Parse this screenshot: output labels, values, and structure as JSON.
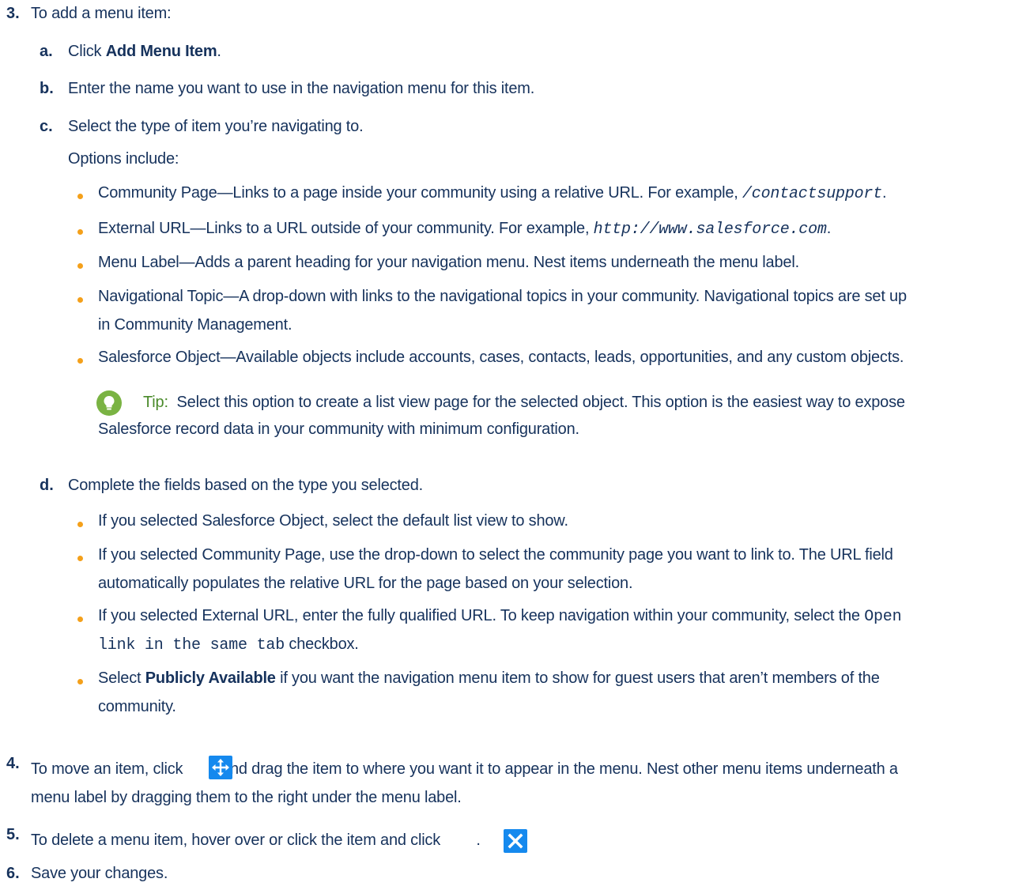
{
  "step3": {
    "num": "3.",
    "text": "To add a menu item:",
    "a": {
      "letter": "a.",
      "pre": "Click ",
      "bold": "Add Menu Item",
      "post": "."
    },
    "b": {
      "letter": "b.",
      "text": "Enter the name you want to use in the navigation menu for this item."
    },
    "c": {
      "letter": "c.",
      "text": "Select the type of item you’re navigating to.",
      "options_intro": "Options include:",
      "options": [
        {
          "pre": "Community Page—Links to a page inside your community using a relative URL. For example, ",
          "code": "/contactsupport",
          "post": "."
        },
        {
          "pre": "External URL—Links to a URL outside of your community. For example, ",
          "code": "http://www.salesforce.com",
          "post": "."
        },
        {
          "line1": "Menu Label—Adds a parent heading for your navigation menu. Nest items underneath the menu label."
        },
        {
          "line1": "Navigational Topic—A drop-down with links to the navigational topics in your community. Navigational topics are set up",
          "line2": "in Community Management."
        },
        {
          "line1": "Salesforce Object—Available objects include accounts, cases, contacts, leads, opportunities, and any custom objects."
        }
      ],
      "tip": {
        "label": "Tip:",
        "line1": "Select this option to create a list view page for the selected object. This option is the easiest way to expose",
        "line2": "Salesforce record data in your community with minimum configuration."
      }
    },
    "d": {
      "letter": "d.",
      "text": "Complete the fields based on the type you selected.",
      "items": [
        {
          "line1": "If you selected Salesforce Object, select the default list view to show."
        },
        {
          "line1": "If you selected Community Page, use the drop-down to select the community page you want to link to. The URL field",
          "line2": "automatically populates the relative URL for the page based on your selection."
        },
        {
          "line1": "If you selected External URL, enter the fully qualified URL. To keep navigation within your community, select the ",
          "code1": "Open",
          "code2": "link in the same tab",
          "line2_post": " checkbox."
        },
        {
          "pre": "Select ",
          "bold": "Publicly Available",
          "line1_post": " if you want the navigation menu item to show for guest users that aren’t members of the",
          "line2": "community."
        }
      ]
    }
  },
  "step4": {
    "num": "4.",
    "pre": "To move an item, click ",
    "post": " and drag the item to where you want it to appear in the menu. Nest other menu items underneath a",
    "line2": "menu label by dragging them to the right under the menu label.",
    "icon": "move-icon"
  },
  "step5": {
    "num": "5.",
    "pre": "To delete a menu item, hover over or click the item and click ",
    "post": ".",
    "icon": "close-icon"
  },
  "step6": {
    "num": "6.",
    "text": "Save your changes."
  },
  "colors": {
    "text": "#16325c",
    "bullet": "#f4a01a",
    "tip_label": "#4a8a2a",
    "tip_icon": "#7ab343",
    "icon_blue": "#1589ee"
  }
}
